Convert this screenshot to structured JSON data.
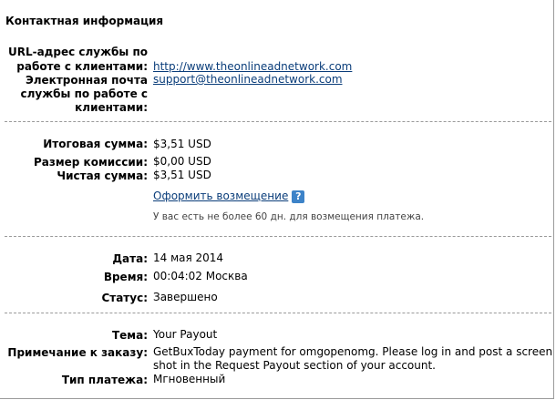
{
  "contact": {
    "section_title": "Контактная информация",
    "url_label_1": "URL-адрес службы по",
    "url_label_2": "работе с клиентами:",
    "url_value": "http://www.theonlineadnetwork.com",
    "email_label_1": "Электронная почта",
    "email_label_2": "службы по работе с",
    "email_label_3": "клиентами:",
    "email_value": "support@theonlineadnetwork.com"
  },
  "amounts": {
    "total_label": "Итоговая сумма:",
    "total_value": "$3,51 USD",
    "fee_label": "Размер комиссии:",
    "fee_value": "$0,00 USD",
    "net_label": "Чистая сумма:",
    "net_value": "$3,51 USD",
    "refund_link": "Оформить возмещение",
    "help_icon": "?",
    "refund_note": "У вас есть не более 60 дн. для возмещения платежа."
  },
  "details": {
    "date_label": "Дата:",
    "date_value": "14 мая 2014",
    "time_label": "Время:",
    "time_value": "00:04:02 Москва",
    "status_label": "Статус:",
    "status_value": "Завершено"
  },
  "order": {
    "subject_label": "Тема:",
    "subject_value": "Your Payout",
    "note_label": "Примечание к заказу:",
    "note_line_1": "GetBuxToday payment for omgopenomg. Please log in and post a screen",
    "note_line_2": "shot in the Request Payout section of your account.",
    "type_label": "Тип платежа:",
    "type_value": "Мгновенный"
  },
  "colors": {
    "link": "#0a3d7a",
    "help_icon_bg": "#3d83c8",
    "separator": "#9a9a9a"
  }
}
